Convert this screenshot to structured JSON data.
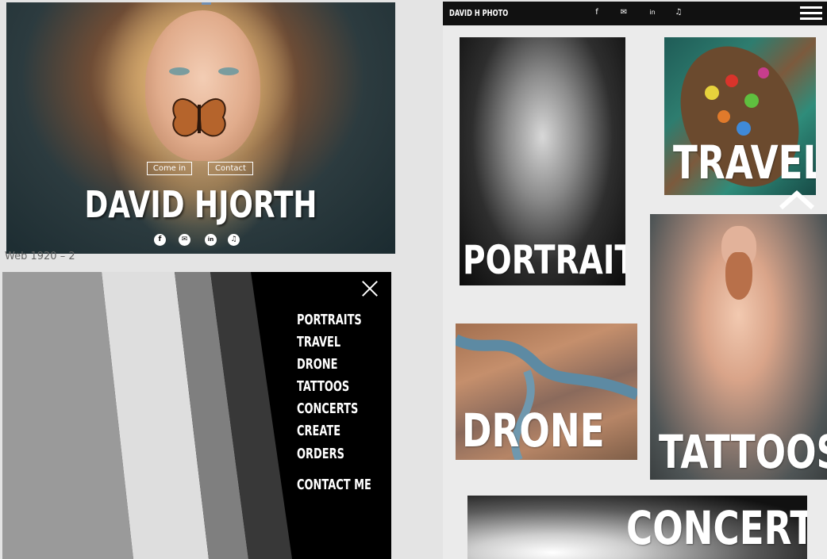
{
  "hero": {
    "come_in": "Come in",
    "contact": "Contact",
    "title": "DAVID HJORTH",
    "social": [
      "f",
      "✉",
      "in",
      "♫"
    ]
  },
  "caption": "Web 1920 – 2",
  "menu": {
    "items": [
      "PORTRAITS",
      "TRAVEL",
      "DRONE",
      "TATTOOS",
      "CONCERTS",
      "CREATE",
      "ORDERS"
    ],
    "contact": "CONTACT ME"
  },
  "site": {
    "brand": "DAVID H PHOTO",
    "topbar_icons": [
      "f",
      "✉",
      "in",
      "♫"
    ],
    "cards": {
      "portraits": "PORTRAITS",
      "travel": "TRAVEL",
      "drone": "DRONE",
      "tattoos": "TATTOOS",
      "concerts": "CONCERTS"
    }
  },
  "colors": {
    "accent": "#2a7be4",
    "topbar": "#111111",
    "page_bg": "#ebebeb"
  }
}
